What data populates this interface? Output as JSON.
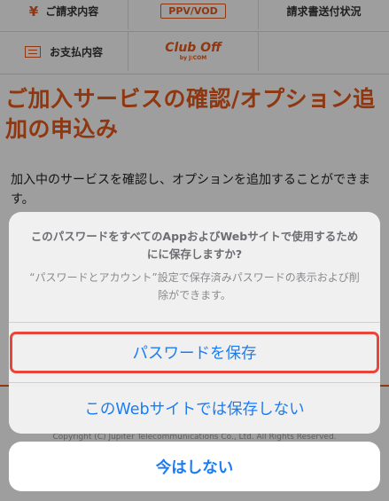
{
  "nav": {
    "row1": {
      "billing": "ご請求内容",
      "ppv": "PPV/VOD",
      "invoice_status": "請求書送付状況"
    },
    "row2": {
      "payment": "お支払内容",
      "club_name": "Club Off",
      "club_by": "by J:COM"
    }
  },
  "page": {
    "title": "ご加入サービスの確認/オプション追加の申込み",
    "lead": "加入中のサービスを確認し、オプションを追加することができます。",
    "copyright": "Copyright (C) Jupiter Telecommunications Co., Ltd. All Rights Reserved."
  },
  "dialog": {
    "title": "このパスワードをすべてのAppおよびWebサイトで使用するためにに保存しますか?",
    "body": "“パスワードとアカウント”設定で保存済みパスワードの表示および削除ができます。",
    "save_label": "パスワードを保存",
    "dont_save_label": "このWebサイトでは保存しない",
    "cancel_label": "今はしない"
  },
  "colors": {
    "accent": "#e55a1c",
    "action": "#1a7cf5",
    "highlight": "#e8463a"
  }
}
